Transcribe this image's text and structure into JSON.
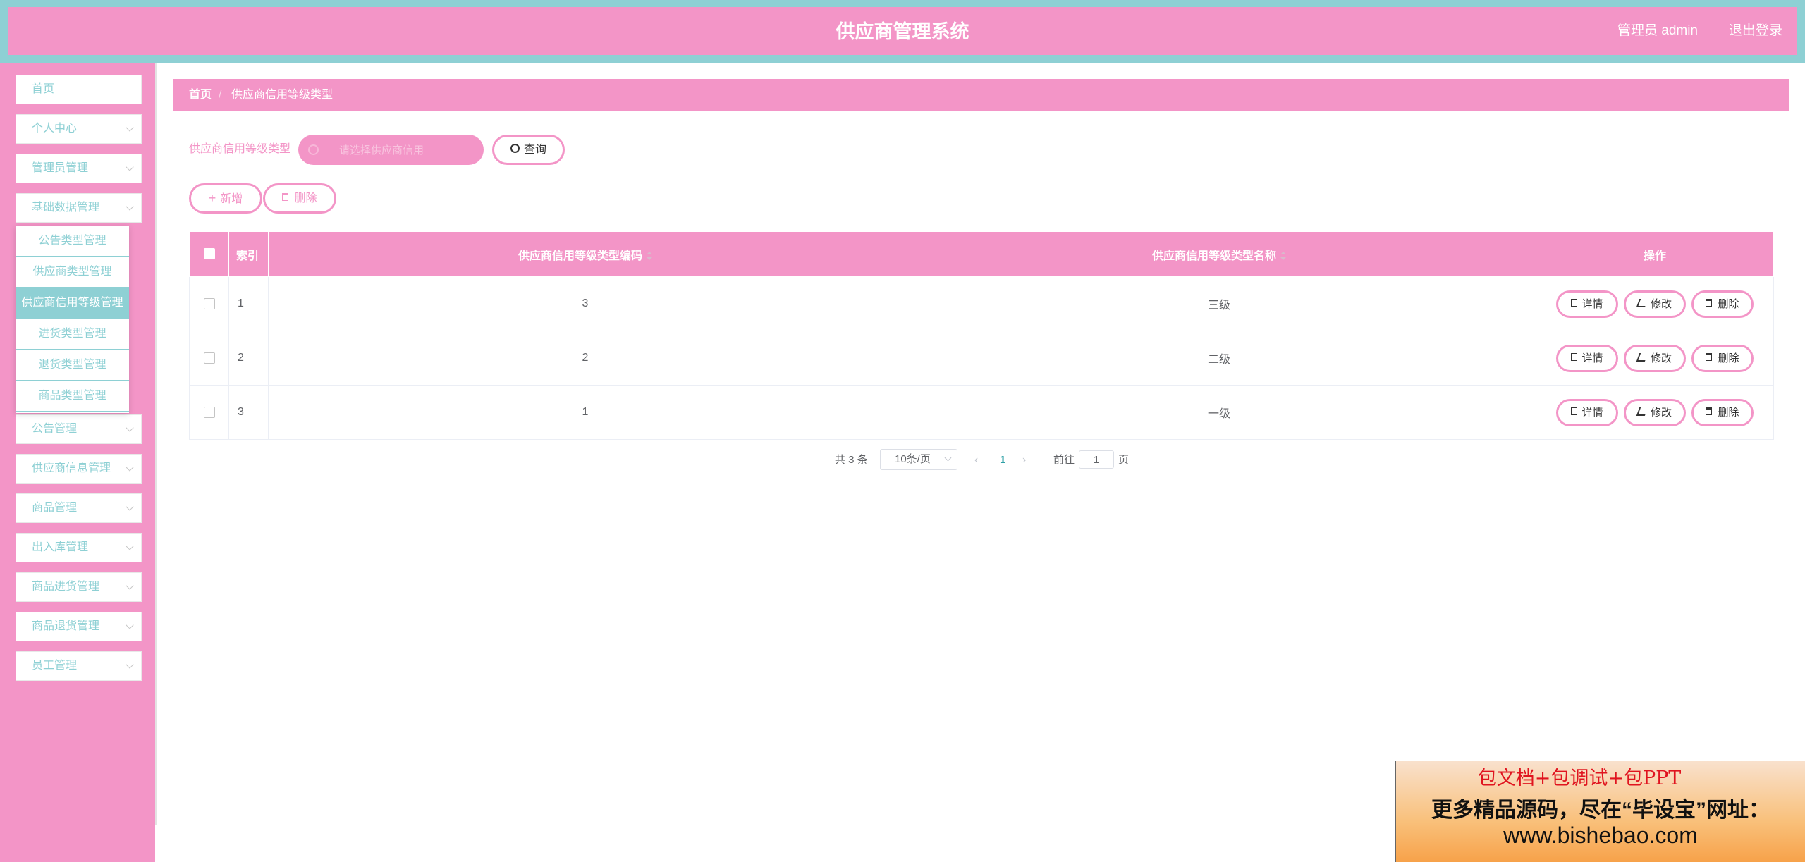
{
  "header": {
    "title": "供应商管理系统",
    "user": "管理员 admin",
    "logout": "退出登录"
  },
  "sidebar": {
    "items": [
      {
        "label": "首页"
      },
      {
        "label": "个人中心"
      },
      {
        "label": "管理员管理"
      },
      {
        "label": "基础数据管理"
      },
      {
        "label": "公告管理"
      },
      {
        "label": "供应商信息管理"
      },
      {
        "label": "商品管理"
      },
      {
        "label": "出入库管理"
      },
      {
        "label": "商品进货管理"
      },
      {
        "label": "商品退货管理"
      },
      {
        "label": "员工管理"
      }
    ],
    "submenu": [
      {
        "label": "公告类型管理"
      },
      {
        "label": "供应商类型管理"
      },
      {
        "label": "供应商信用等级管理"
      },
      {
        "label": "进货类型管理"
      },
      {
        "label": "退货类型管理"
      },
      {
        "label": "商品类型管理"
      }
    ]
  },
  "breadcrumb": {
    "home": "首页",
    "sep": "/",
    "current": "供应商信用等级类型"
  },
  "search": {
    "label": "供应商信用等级类型",
    "placeholder": "请选择供应商信用",
    "query": "查询"
  },
  "actions": {
    "add": "新增",
    "delete": "删除"
  },
  "table": {
    "headers": {
      "index": "索引",
      "code": "供应商信用等级类型编码",
      "name": "供应商信用等级类型名称",
      "ops": "操作"
    },
    "rows": [
      {
        "index": "1",
        "code": "3",
        "name": "三级"
      },
      {
        "index": "2",
        "code": "2",
        "name": "二级"
      },
      {
        "index": "3",
        "code": "1",
        "name": "一级"
      }
    ],
    "row_actions": {
      "detail": "详情",
      "edit": "修改",
      "delete": "删除"
    }
  },
  "pagination": {
    "total": "共 3 条",
    "page_size": "10条/页",
    "current_page": "1",
    "goto": "前往",
    "jump_value": "1",
    "page_unit": "页"
  },
  "ad": {
    "line1": "包文档+包调试+包PPT",
    "line2": "更多精品源码，尽在“毕设宝”网址：",
    "line3": "www.bishebao.com"
  },
  "colors": {
    "primary_pink": "#f395c7",
    "teal": "#8ed0d4"
  }
}
